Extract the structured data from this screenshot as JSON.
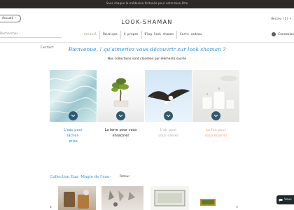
{
  "announcement": "Sous chaque la médecine fortunée pour votre bien-être",
  "header": {
    "back_label": "Accueil",
    "logo": "LOOK-SHAMAN",
    "language": "Besieu (5)"
  },
  "search": {
    "placeholder": "Rechercher..."
  },
  "nav": {
    "items": [
      "Accueil",
      "Boutique",
      "À propos",
      "Blog look shaman",
      "Carte cadeau"
    ]
  },
  "login_label": "Connexion",
  "contact_label": "Contact",
  "welcome": "Bienvenue, ! qu'aimeriez vous découvrir sur look shaman ?",
  "subtitle": "Nos collections sont classées par éléments sacrés",
  "elements": [
    {
      "caption": "L'eau pour lâcher-prise",
      "color": "#2d8fd6",
      "icon": "water-surface-photo"
    },
    {
      "caption": "La terre pour vous enraciner",
      "color": "#222222",
      "icon": "bonsai-tree-photo"
    },
    {
      "caption": "L'air pour vous élever",
      "color": "#b8b8b8",
      "icon": "eagle-photo"
    },
    {
      "caption": "Le feu pour vous éclairer",
      "color": "#f1a98a",
      "icon": "candles-photo"
    }
  ],
  "collection": {
    "title": "Collection Eau -Magie de l'eau-",
    "back_label": "Retour"
  },
  "chat_label": "Vous"
}
